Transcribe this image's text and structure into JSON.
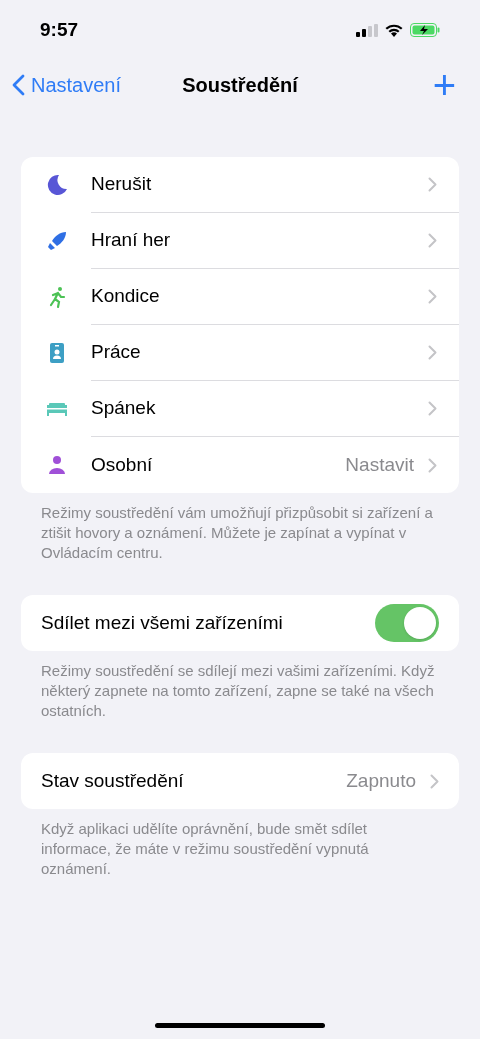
{
  "status_bar": {
    "time": "9:57"
  },
  "nav": {
    "back": "Nastavení",
    "title": "Soustředění",
    "add": "+"
  },
  "focus_modes": [
    {
      "label": "Nerušit",
      "kind": "moon",
      "color": "#5856d6"
    },
    {
      "label": "Hraní her",
      "kind": "rocket",
      "color": "#2f6fe4"
    },
    {
      "label": "Kondice",
      "kind": "runner",
      "color": "#4cc255"
    },
    {
      "label": "Práce",
      "kind": "badge",
      "color": "#3d9fc4"
    },
    {
      "label": "Spánek",
      "kind": "bed",
      "color": "#5ac8b8"
    },
    {
      "label": "Osobní",
      "kind": "person",
      "color": "#a050d8",
      "value": "Nastavit"
    }
  ],
  "focus_modes_footer": "Režimy soustředění vám umožňují přizpůsobit si zařízení a ztišit hovory a oznámení. Můžete je zapínat a vypínat v Ovládacím centru.",
  "share": {
    "label": "Sdílet mezi všemi zařízeními",
    "on": true
  },
  "share_footer": "Režimy soustředění se sdílejí mezi vašimi zařízeními. Když některý zapnete na tomto zařízení, zapne se také na všech ostatních.",
  "focus_status": {
    "label": "Stav soustředění",
    "value": "Zapnuto"
  },
  "focus_status_footer": "Když aplikaci udělíte oprávnění, bude smět sdílet informace, že máte v režimu soustředění vypnutá oznámení."
}
